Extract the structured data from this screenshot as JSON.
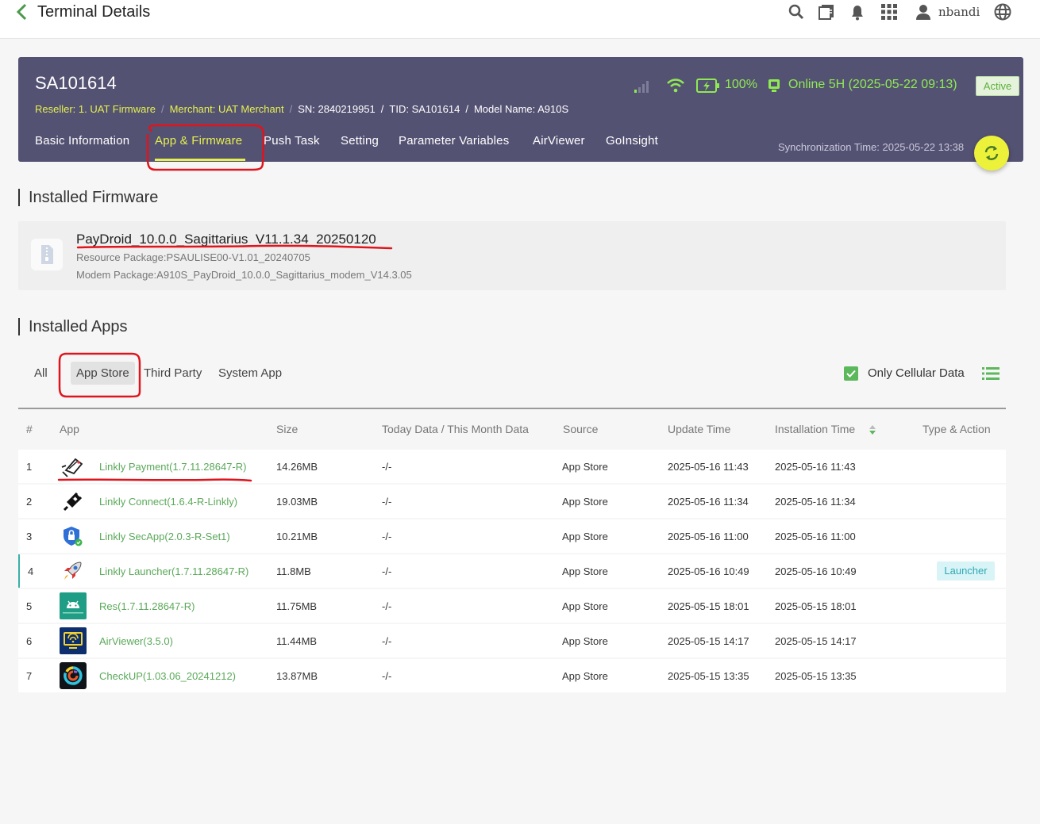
{
  "topbar": {
    "title": "Terminal Details",
    "username": "nbandi",
    "icons": [
      "back-arrow-icon",
      "search-icon",
      "book-icon",
      "bell-icon",
      "apps-grid-icon",
      "user-icon",
      "globe-icon"
    ]
  },
  "terminal": {
    "sn_title": "SA101614",
    "reseller": "Reseller: 1. UAT Firmware",
    "merchant": "Merchant: UAT Merchant",
    "serial": "SN: 2840219951",
    "tid": "TID: SA101614",
    "model": "Model Name: A910S",
    "battery": "100%",
    "online": "Online 5H (2025-05-22 09:13)",
    "status_badge": "Active",
    "sync_time": "Synchronization Time: 2025-05-22 13:38"
  },
  "tabs": [
    {
      "label": "Basic Information"
    },
    {
      "label": "App & Firmware"
    },
    {
      "label": "Push Task"
    },
    {
      "label": "Setting"
    },
    {
      "label": "Parameter Variables"
    },
    {
      "label": "AirViewer"
    },
    {
      "label": "GoInsight"
    }
  ],
  "firmware": {
    "section_title": "Installed Firmware",
    "name": "PayDroid_10.0.0_Sagittarius_V11.1.34_20250120",
    "resource": "Resource Package:PSAULISE00-V1.01_20240705",
    "modem": "Modem Package:A910S_PayDroid_10.0.0_Sagittarius_modem_V14.3.05"
  },
  "apps": {
    "section_title": "Installed Apps",
    "filters": [
      "All",
      "App Store",
      "Third Party",
      "System App"
    ],
    "only_cellular": "Only Cellular Data",
    "headers": [
      "#",
      "App",
      "Size",
      "Today Data / This Month Data",
      "Source",
      "Update Time",
      "Installation Time",
      "Type & Action"
    ],
    "rows": [
      {
        "no": "1",
        "app": "Linkly Payment(1.7.11.28647-R)",
        "size": "14.26MB",
        "data": "-/-",
        "source": "App Store",
        "update": "2025-05-16 11:43",
        "install": "2025-05-16 11:43",
        "tag": ""
      },
      {
        "no": "2",
        "app": "Linkly Connect(1.6.4-R-Linkly)",
        "size": "19.03MB",
        "data": "-/-",
        "source": "App Store",
        "update": "2025-05-16 11:34",
        "install": "2025-05-16 11:34",
        "tag": ""
      },
      {
        "no": "3",
        "app": "Linkly SecApp(2.0.3-R-Set1)",
        "size": "10.21MB",
        "data": "-/-",
        "source": "App Store",
        "update": "2025-05-16 11:00",
        "install": "2025-05-16 11:00",
        "tag": ""
      },
      {
        "no": "4",
        "app": "Linkly Launcher(1.7.11.28647-R)",
        "size": "11.8MB",
        "data": "-/-",
        "source": "App Store",
        "update": "2025-05-16 10:49",
        "install": "2025-05-16 10:49",
        "tag": "Launcher"
      },
      {
        "no": "5",
        "app": "Res(1.7.11.28647-R)",
        "size": "11.75MB",
        "data": "-/-",
        "source": "App Store",
        "update": "2025-05-15 18:01",
        "install": "2025-05-15 18:01",
        "tag": ""
      },
      {
        "no": "6",
        "app": "AirViewer(3.5.0)",
        "size": "11.44MB",
        "data": "-/-",
        "source": "App Store",
        "update": "2025-05-15 14:17",
        "install": "2025-05-15 14:17",
        "tag": ""
      },
      {
        "no": "7",
        "app": "CheckUP(1.03.06_20241212)",
        "size": "13.87MB",
        "data": "-/-",
        "source": "App Store",
        "update": "2025-05-15 13:35",
        "install": "2025-05-15 13:35",
        "tag": ""
      }
    ]
  },
  "colors": {
    "header_bg": "#545273",
    "accent_yellow": "#e6f04e",
    "online_green": "#8fea52",
    "link_green": "#5aa95a",
    "annotation_red": "#e0141c"
  }
}
